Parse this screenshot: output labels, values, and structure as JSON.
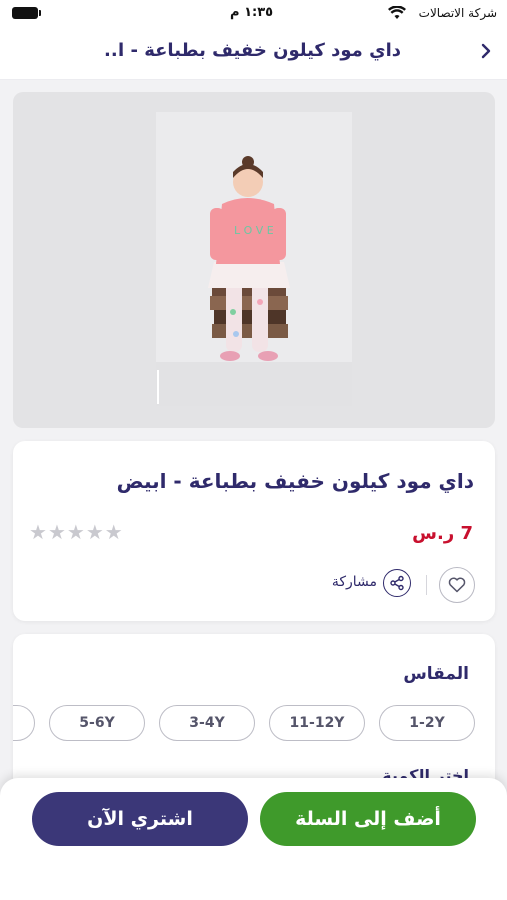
{
  "status_bar": {
    "carrier": "شركة الاتصالات",
    "time": "١:٣٥ م"
  },
  "header": {
    "title": "داي مود كيلون خفيف بطباعة - ا",
    "ellipsis": "..."
  },
  "product": {
    "title": "داي مود كيلون خفيف بطباعة - ابيض",
    "price": "7 ر.س",
    "rating_stars": 0,
    "rating_max": 5,
    "share_label": "مشاركة"
  },
  "options": {
    "size_heading": "المقاس",
    "sizes": [
      "1-2Y",
      "11-12Y",
      "3-4Y",
      "5-6Y"
    ],
    "quantity_heading": "اختر الكمية"
  },
  "actions": {
    "add_to_cart": "أضف إلى السلة",
    "buy_now": "اشتري الآن"
  },
  "colors": {
    "brand_navy": "#2f2a6b",
    "price_red": "#c8102e",
    "cart_green": "#3f9a2b",
    "buy_purple": "#3b3778"
  },
  "icons": [
    "battery-icon",
    "wifi-icon",
    "chevron-right-icon",
    "heart-icon",
    "share-icon",
    "star-icon"
  ]
}
